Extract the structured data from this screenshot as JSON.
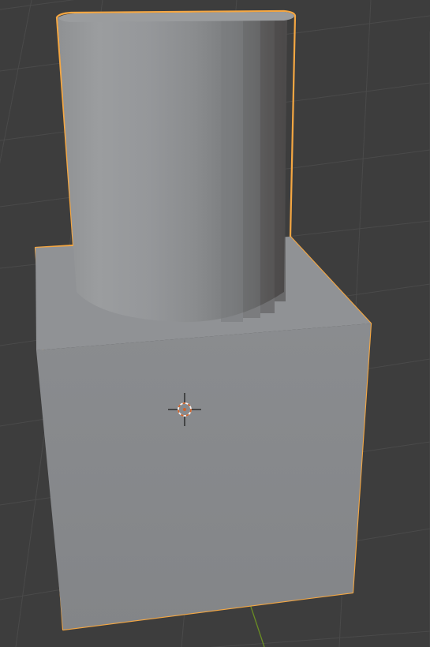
{
  "viewport": {
    "background": "#3d3d3d",
    "grid_line_color": "#4a4a4a",
    "y_axis_color": "#6b8e23",
    "selection_outline_color": "#f5a742"
  },
  "scene": {
    "selected_object": "cylinder-on-cube",
    "cube_face_front": "#85878a",
    "cube_face_top": "#909295",
    "cylinder_light": "#9b9d9f",
    "cylinder_dark": "#4e4b4b",
    "cylinder_top": "#9a9c9e",
    "cursor_ring_outer": "#f2f2f2",
    "cursor_ring_inner": "#d0642c"
  },
  "icons": {
    "cursor": "3d-cursor-icon"
  }
}
